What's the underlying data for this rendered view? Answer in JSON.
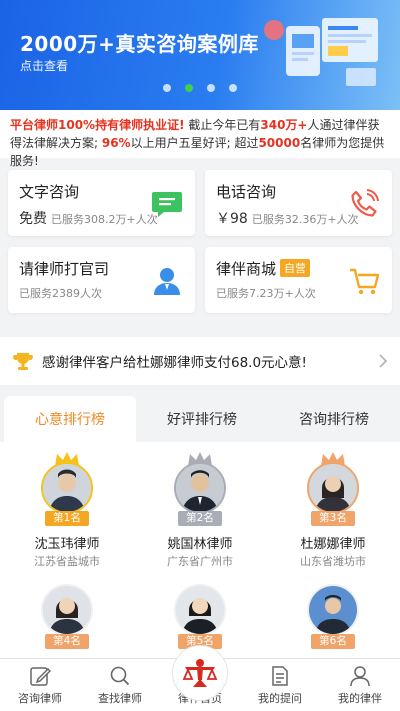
{
  "banner": {
    "title": "2000万+真实咨询案例库",
    "subtitle": "点击查看",
    "dots": 4,
    "active_dot": 2
  },
  "notice": {
    "p1": "平台律师100%持有律师执业证!",
    "p2": " 截止今年已有",
    "p3": "340万+",
    "p4": "人通过律伴获得法律解决方案; ",
    "p5": "96%",
    "p6": "以上用户五星好评; 超过",
    "p7": "50000",
    "p8": "名律师为您提供服务!"
  },
  "services": [
    {
      "title": "文字咨询",
      "lead": "免费",
      "desc": "已服务308.2万+人次",
      "icon": "chat-icon"
    },
    {
      "title": "电话咨询",
      "lead": "￥98",
      "desc": "已服务32.36万+人次",
      "icon": "phone-icon"
    },
    {
      "title": "请律师打官司",
      "lead": "",
      "desc": "已服务2389人次",
      "icon": "lawyer-icon"
    },
    {
      "title": "律伴商城",
      "tag": "自营",
      "lead": "",
      "desc": "已服务7.23万+人次",
      "icon": "cart-icon"
    }
  ],
  "thanks": {
    "text": "感谢律伴客户给杜娜娜律师支付68.0元心意!",
    "icon": "trophy-icon"
  },
  "tabs": [
    "心意排行榜",
    "好评排行榜",
    "咨询排行榜"
  ],
  "active_tab": 0,
  "lawyers": [
    {
      "rank": "第1名",
      "name": "沈玉玮律师",
      "loc": "江苏省盐城市"
    },
    {
      "rank": "第2名",
      "name": "姚国林律师",
      "loc": "广东省广州市"
    },
    {
      "rank": "第3名",
      "name": "杜娜娜律师",
      "loc": "山东省潍坊市"
    },
    {
      "rank": "第4名",
      "name": "",
      "loc": ""
    },
    {
      "rank": "第5名",
      "name": "",
      "loc": ""
    },
    {
      "rank": "第6名",
      "name": "",
      "loc": ""
    }
  ],
  "nav": [
    {
      "label": "咨询律师",
      "icon": "edit-icon"
    },
    {
      "label": "查找律师",
      "icon": "search-icon"
    },
    {
      "label": "律伴首页",
      "icon": "home-logo-icon"
    },
    {
      "label": "我的提问",
      "icon": "document-icon"
    },
    {
      "label": "我的律伴",
      "icon": "user-icon"
    }
  ],
  "colors": {
    "accent_orange": "#f08a24",
    "notice_red": "#e8321f",
    "gold": "#f5a623",
    "silver": "#a9aeb6",
    "bronze": "#f0a46a",
    "brand_blue": "#1b63e6"
  }
}
